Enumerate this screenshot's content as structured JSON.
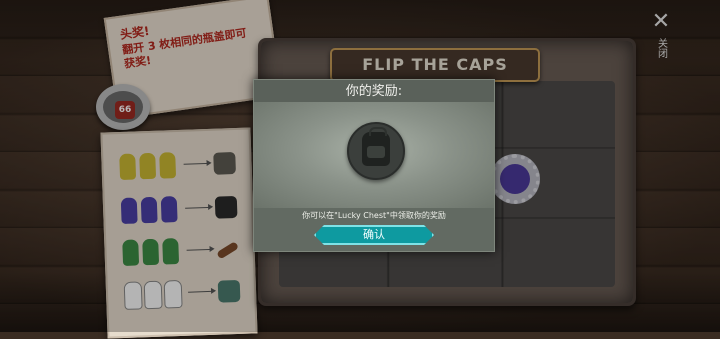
{
  "note": {
    "title": "头奖!",
    "body": "翻开 3 枚相同的瓶盖即可获奖!"
  },
  "ring": {
    "badge": "66"
  },
  "board": {
    "title": "FLIP THE CAPS"
  },
  "close": {
    "label": "关闭"
  },
  "dialog": {
    "title": "你的奖励:",
    "reward_icon": "backpack-icon",
    "hint": "你可以在\"Lucky Chest\"中领取你的奖励",
    "confirm_label": "确认"
  },
  "rewards_card": {
    "rows": [
      {
        "cap_color": "#c9b733",
        "reward_icon": "flashlight-icon"
      },
      {
        "cap_color": "#4a3fa6",
        "reward_icon": "backpack-icon"
      },
      {
        "cap_color": "#3c8b45",
        "reward_icon": "rifle-icon"
      },
      {
        "cap_color": "#ffffff",
        "reward_icon": "tools-icon"
      }
    ]
  },
  "colors": {
    "accent": "#0e9aa0",
    "note_text": "#b3291f"
  }
}
